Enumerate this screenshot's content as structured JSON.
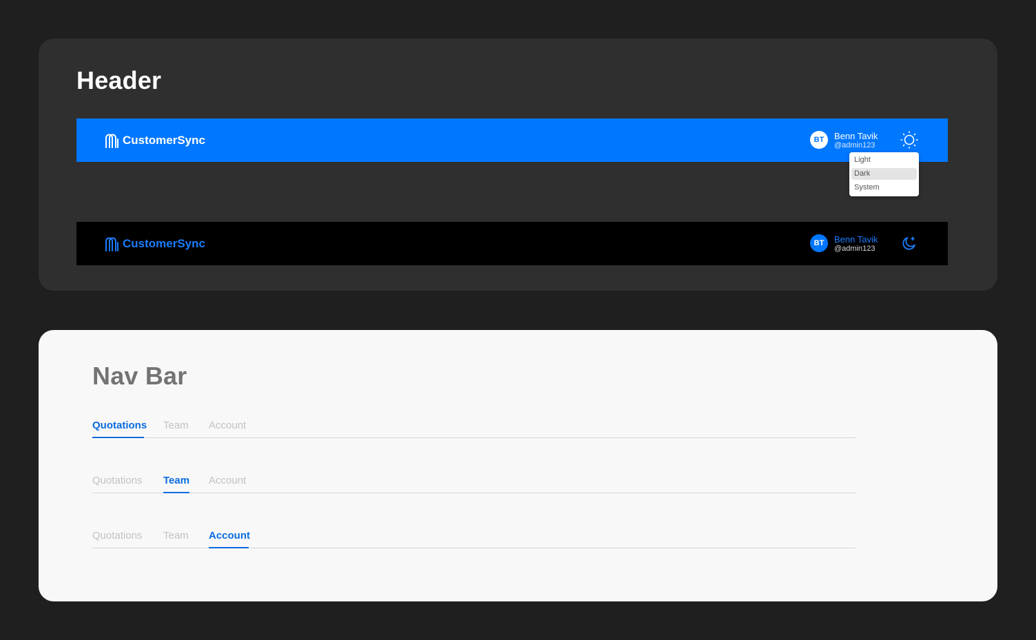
{
  "header_section": {
    "title": "Header",
    "light_header": {
      "brand": "CustomerSync",
      "avatar_initials": "BT",
      "user_name": "Benn Tavik",
      "user_handle": "@admin123",
      "theme_icon": "sun-icon"
    },
    "theme_menu": {
      "options": [
        "Light",
        "Dark",
        "System"
      ],
      "selected": "Dark"
    },
    "dark_header": {
      "brand": "CustomerSync",
      "avatar_initials": "BT",
      "user_name": "Benn Tavik",
      "user_handle": "@admin123",
      "theme_icon": "moon-icon"
    }
  },
  "navbar_section": {
    "title": "Nav Bar",
    "navbars": [
      {
        "tabs": [
          "Quotations",
          "Team",
          "Account"
        ],
        "active": "Quotations"
      },
      {
        "tabs": [
          "Quotations",
          "Team",
          "Account"
        ],
        "active": "Team"
      },
      {
        "tabs": [
          "Quotations",
          "Team",
          "Account"
        ],
        "active": "Account"
      }
    ]
  },
  "colors": {
    "brand_blue": "#0077ff",
    "active_tab": "#0a6ce0",
    "inactive_tab": "#c2c2c2",
    "page_bg": "#1f1f1f",
    "dark_panel": "#2f2f2f",
    "light_panel": "#f8f8f8"
  }
}
